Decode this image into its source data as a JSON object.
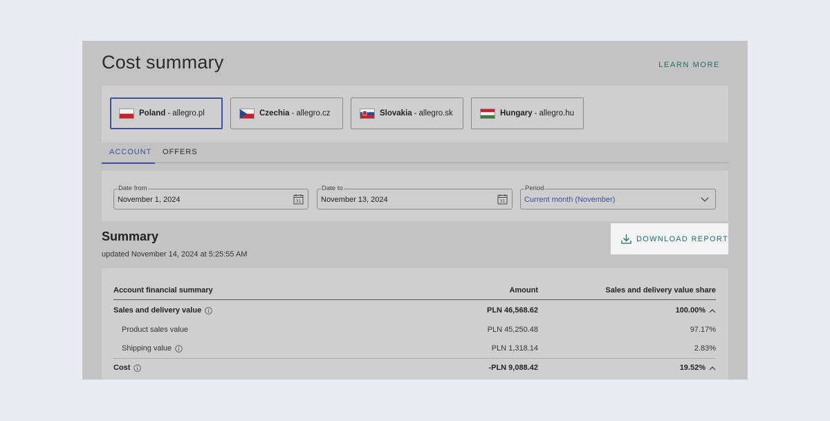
{
  "page": {
    "title": "Cost summary",
    "learn_more": "LEARN MORE"
  },
  "countries": [
    {
      "name": "Poland",
      "domain": "allegro.pl",
      "flag": "poland-flag",
      "active": true
    },
    {
      "name": "Czechia",
      "domain": "allegro.cz",
      "flag": "czechia-flag",
      "active": false
    },
    {
      "name": "Slovakia",
      "domain": "allegro.sk",
      "flag": "slovakia-flag",
      "active": false
    },
    {
      "name": "Hungary",
      "domain": "allegro.hu",
      "flag": "hungary-flag",
      "active": false
    }
  ],
  "tabs": [
    {
      "label": "ACCOUNT",
      "active": true
    },
    {
      "label": "OFFERS",
      "active": false
    }
  ],
  "filters": {
    "date_from": {
      "label": "Date from",
      "value": "November 1, 2024"
    },
    "date_to": {
      "label": "Date to",
      "value": "November 13, 2024"
    },
    "period": {
      "label": "Period",
      "value": "Current month (November)"
    }
  },
  "summary": {
    "title": "Summary",
    "updated": "updated November 14, 2024 at 5:25:55 AM",
    "download_label": "DOWNLOAD REPORT"
  },
  "table": {
    "headers": {
      "col1": "Account financial summary",
      "col2": "Amount",
      "col3": "Sales and delivery value share"
    },
    "rows": [
      {
        "label": "Sales and delivery value",
        "amount": "PLN 46,568.62",
        "share": "100.00%"
      },
      {
        "label": "Product sales value",
        "amount": "PLN 45,250.48",
        "share": "97.17%"
      },
      {
        "label": "Shipping value",
        "amount": "PLN 1,318.14",
        "share": "2.83%"
      },
      {
        "label": "Cost",
        "amount": "-PLN 9,088.42",
        "share": "19.52%"
      }
    ]
  },
  "colors": {
    "accent_blue": "#3c4fa3",
    "accent_teal": "#1c6f6a",
    "overlay_gray": "#c3c3c3"
  }
}
